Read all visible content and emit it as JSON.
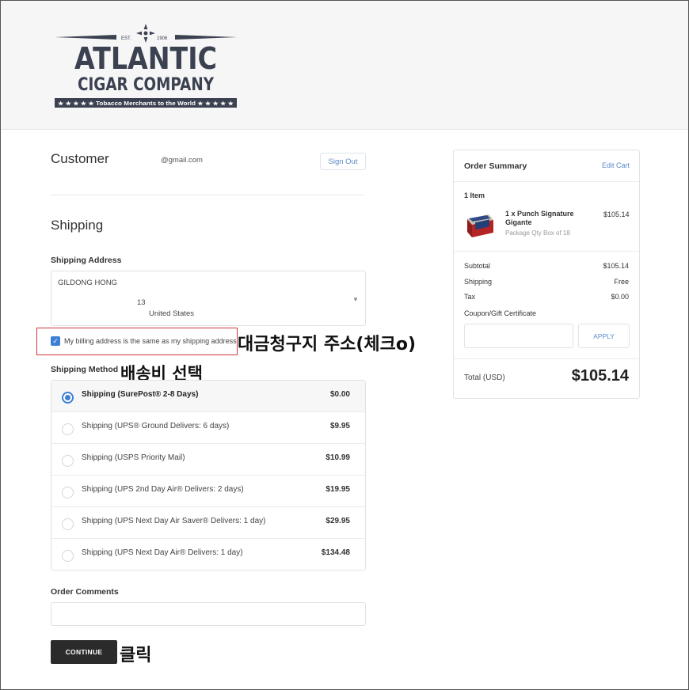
{
  "brand": {
    "est": "EST.",
    "year": "1906",
    "line1": "ATLANTIC",
    "line2": "CIGAR COMPANY",
    "tagline": "★ ★ ★ ★ ★ Tobacco Merchants to the World ★ ★ ★ ★ ★"
  },
  "customer": {
    "heading": "Customer",
    "email": "@gmail.com",
    "sign_out": "Sign Out"
  },
  "shipping": {
    "heading": "Shipping",
    "address_label": "Shipping Address",
    "address": {
      "name": "GILDONG HONG",
      "line": "13",
      "country": "United States"
    },
    "billing_same_label": "My billing address is the same as my shipping address",
    "billing_same_checked": true,
    "method_label": "Shipping Method",
    "methods": [
      {
        "name": "Shipping (SurePost® 2-8 Days)",
        "price": "$0.00",
        "selected": true
      },
      {
        "name": "Shipping (UPS® Ground Delivers: 6 days)",
        "price": "$9.95",
        "selected": false
      },
      {
        "name": "Shipping (USPS Priority Mail)",
        "price": "$10.99",
        "selected": false
      },
      {
        "name": "Shipping (UPS 2nd Day Air® Delivers: 2 days)",
        "price": "$19.95",
        "selected": false
      },
      {
        "name": "Shipping (UPS Next Day Air Saver® Delivers: 1 day)",
        "price": "$29.95",
        "selected": false
      },
      {
        "name": "Shipping (UPS Next Day Air® Delivers: 1 day)",
        "price": "$134.48",
        "selected": false
      }
    ],
    "comments_label": "Order Comments",
    "comments_value": "",
    "continue_label": "CONTINUE"
  },
  "annotations": {
    "billing": "대금청구지 주소(체크o)",
    "shipping_method": "배송비 선택",
    "click": "클릭"
  },
  "summary": {
    "title": "Order Summary",
    "edit_cart": "Edit Cart",
    "item_count": "1 Item",
    "product": {
      "name": "1 x Punch Signature Gigante",
      "option": "Package Qty Box of 18",
      "price": "$105.14"
    },
    "subtotal_label": "Subtotal",
    "subtotal": "$105.14",
    "shipping_label": "Shipping",
    "shipping": "Free",
    "tax_label": "Tax",
    "tax": "$0.00",
    "coupon_label": "Coupon/Gift Certificate",
    "coupon_value": "",
    "apply_label": "APPLY",
    "total_label": "Total (USD)",
    "total": "$105.14"
  },
  "colors": {
    "accent": "#3e7fd6",
    "link": "#5b8ac8",
    "highlight_box": "#d0353b",
    "brand_dark": "#3b4150"
  }
}
